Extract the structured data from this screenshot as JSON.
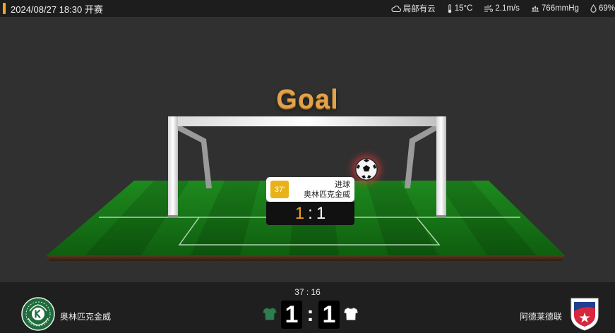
{
  "header": {
    "title": "2024/08/27 18:30 开赛"
  },
  "weather": {
    "sky": "局部有云",
    "temperature": "15°C",
    "wind": "2.1m/s",
    "pressure": "766mmHg",
    "humidity": "69%"
  },
  "animation": {
    "headline": "Goal",
    "event_minute": "37'",
    "event_type": "进球",
    "event_team": "奥林匹克金威",
    "score_home": "1",
    "score_separator": ":",
    "score_away": "1"
  },
  "match": {
    "clock": "37 : 16",
    "home": {
      "name": "奥林匹克金威",
      "shirt_color": "#2e7d4f",
      "score": "1"
    },
    "away": {
      "name": "阿德莱德联",
      "shirt_color": "#ffffff",
      "score": "1"
    },
    "separator": ":"
  },
  "colors": {
    "accent": "#f5a623",
    "minute_badge": "#e8b21a",
    "home_score": "#f0a030"
  },
  "icons": [
    "cloud-icon",
    "thermometer-icon",
    "wind-icon",
    "pressure-icon",
    "humidity-icon",
    "soccer-ball-icon",
    "home-shirt-icon",
    "away-shirt-icon",
    "home-team-logo",
    "away-team-logo"
  ]
}
